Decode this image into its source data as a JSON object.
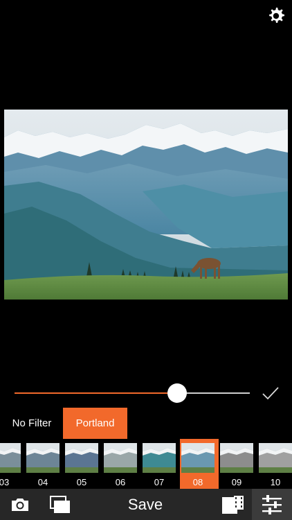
{
  "toolbar": {
    "settings_icon": "gear-icon"
  },
  "photo": {
    "description_icon": "landscape-photo"
  },
  "intensity": {
    "value": 0.69,
    "accent": "#f2692b"
  },
  "filter_tabs": {
    "no_filter": "No Filter",
    "selected": "Portland"
  },
  "thumbnails": [
    {
      "label": "03",
      "tone": "#7b8f9a"
    },
    {
      "label": "04",
      "tone": "#6d8596"
    },
    {
      "label": "05",
      "tone": "#5b7592"
    },
    {
      "label": "06",
      "tone": "#9aa7a8"
    },
    {
      "label": "07",
      "tone": "#3f8a93"
    },
    {
      "label": "08",
      "tone": "#6a98b0",
      "selected": true
    },
    {
      "label": "09",
      "tone": "#8d8d8d"
    },
    {
      "label": "10",
      "tone": "#a0a0a0"
    }
  ],
  "bottom_bar": {
    "save_label": "Save"
  },
  "colors": {
    "accent": "#f2692b",
    "bar": "#272727"
  }
}
